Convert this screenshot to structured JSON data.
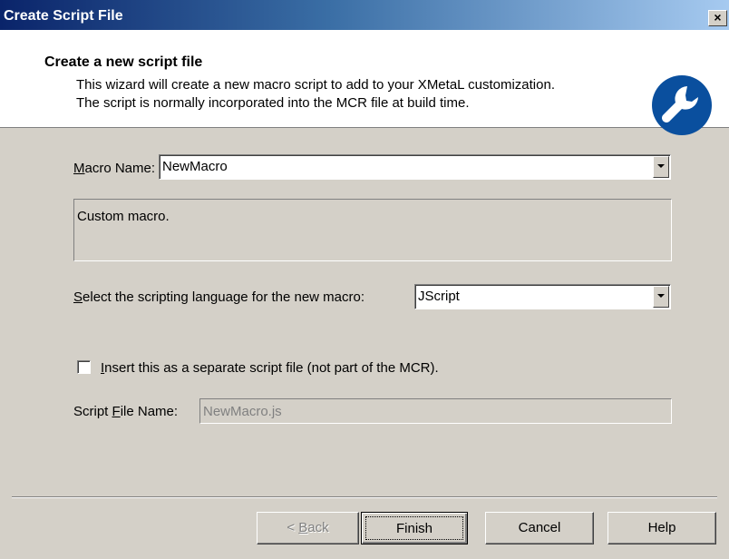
{
  "window": {
    "title": "Create Script File",
    "close_label": "×"
  },
  "header": {
    "title": "Create a new script file",
    "desc_line1": "This wizard will create a new macro script to add to your XMetaL customization.",
    "desc_line2": "The script is normally incorporated into the MCR file at build time."
  },
  "macro": {
    "label_prefix": "",
    "label_key": "M",
    "label_rest": "acro Name:",
    "value": "NewMacro",
    "description": "Custom macro."
  },
  "language": {
    "label_key": "S",
    "label_rest": "elect the scripting language for the new macro:",
    "value": "JScript"
  },
  "separate_file": {
    "label_key": "I",
    "label_rest": "nsert this as a separate script file (not part of the MCR).",
    "checked": false
  },
  "script_file": {
    "label_prefix": "Script ",
    "label_key": "F",
    "label_rest": "ile Name:",
    "value": "NewMacro.js"
  },
  "buttons": {
    "back_prefix": "< ",
    "back_key": "B",
    "back_rest": "ack",
    "finish": "Finish",
    "cancel": "Cancel",
    "help": "Help"
  },
  "colors": {
    "dialog_bg": "#d4d0c8",
    "titlebar": "#0a246a",
    "logo_blue": "#0a4f9e"
  }
}
